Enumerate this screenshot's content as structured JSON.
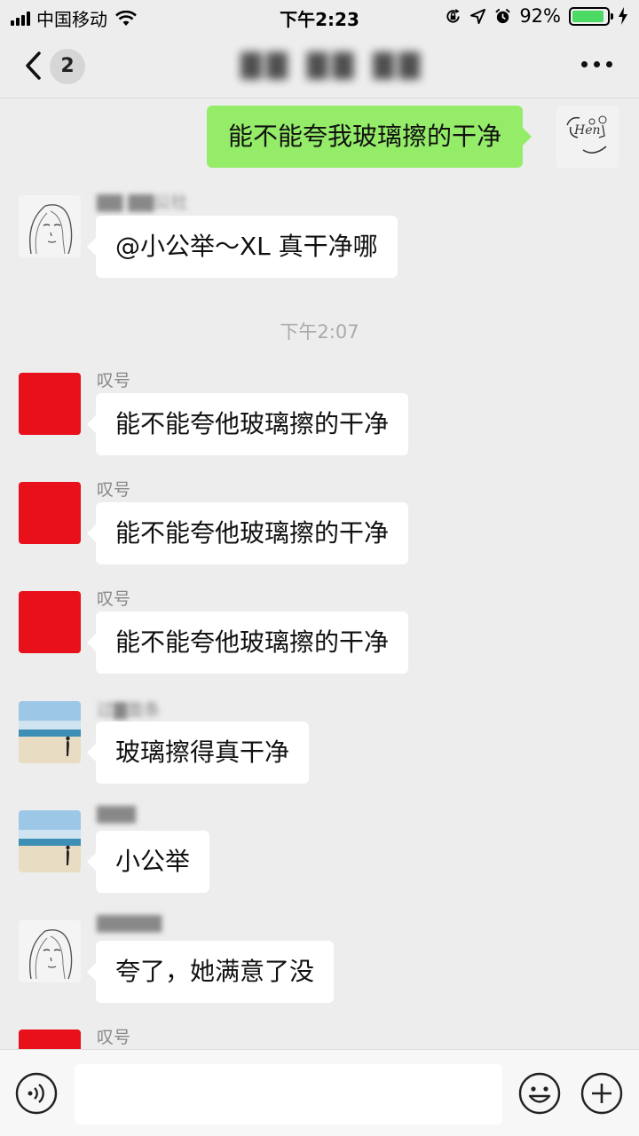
{
  "status_bar": {
    "carrier": "中国移动",
    "time": "下午2:23",
    "battery": "92%",
    "battery_level": 0.92
  },
  "nav": {
    "unread_count": "2",
    "title": "▇▇ ▇▇ ▇▇"
  },
  "timestamp": "下午2:07",
  "messages": [
    {
      "side": "out",
      "text": "能不能夸我玻璃擦的干净"
    },
    {
      "side": "in",
      "sender": "▇▇ ▇▇公社",
      "text": "@小公举～XL 真干净哪"
    },
    {
      "side": "in",
      "sender": "叹号",
      "text": "能不能夸他玻璃擦的干净"
    },
    {
      "side": "in",
      "sender": "叹号",
      "text": "能不能夸他玻璃擦的干净"
    },
    {
      "side": "in",
      "sender": "叹号",
      "text": "能不能夸他玻璃擦的干净"
    },
    {
      "side": "in",
      "sender": "过▇面条",
      "text": "玻璃擦得真干净"
    },
    {
      "side": "in",
      "sender": "▇▇▇",
      "text": "小公举"
    },
    {
      "side": "in",
      "sender": "▇▇▇▇▇",
      "text": "夸了，她满意了没"
    },
    {
      "side": "in",
      "sender": "叹号",
      "text": ""
    }
  ],
  "input": {
    "placeholder": ""
  },
  "colors": {
    "out_bubble": "#95ec69",
    "in_bubble": "#ffffff",
    "red_avatar": "#e8101b",
    "background": "#ededed"
  }
}
